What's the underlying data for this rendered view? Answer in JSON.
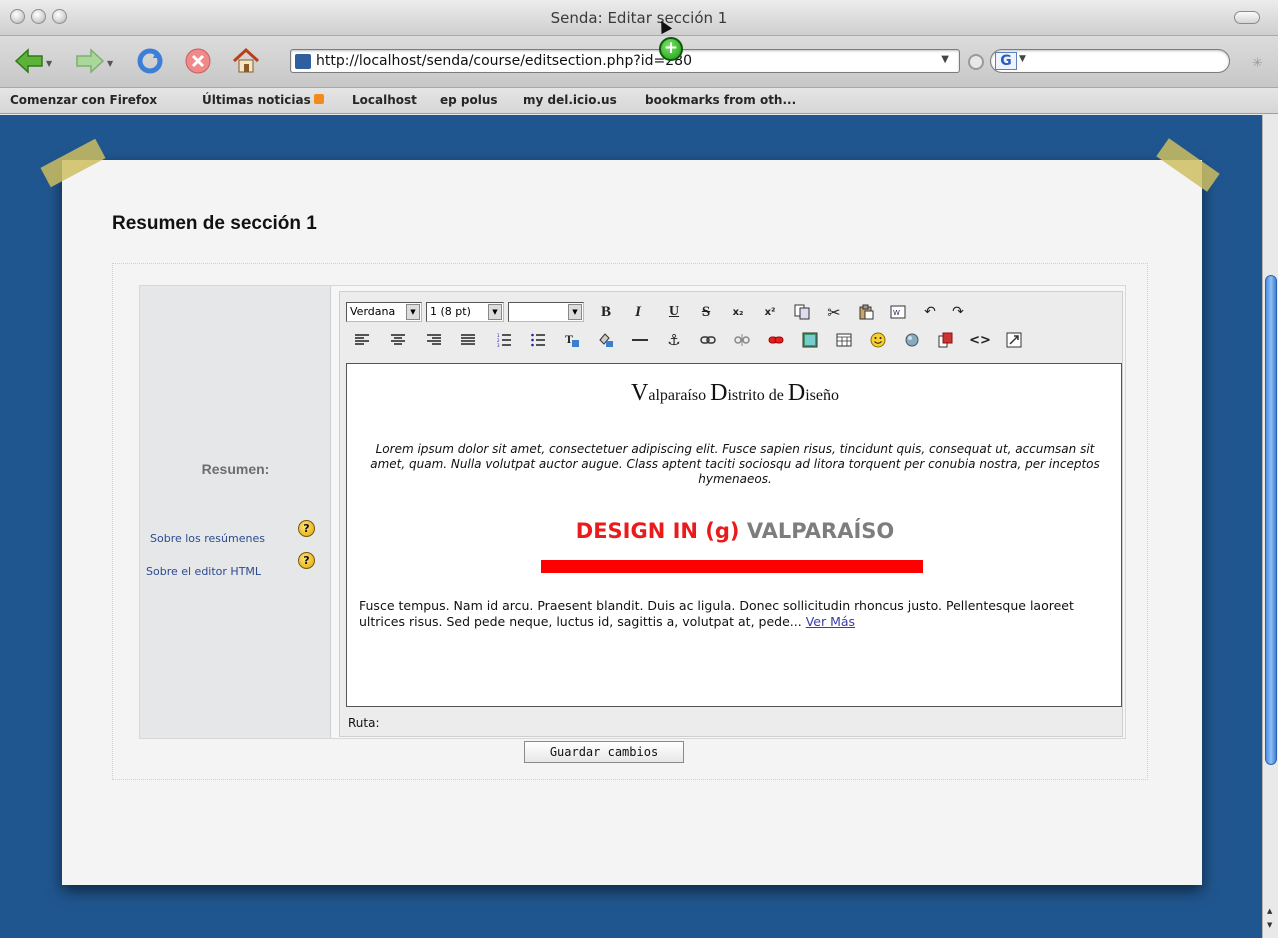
{
  "window": {
    "title": "Senda: Editar sección 1"
  },
  "navbar": {
    "url": "http://localhost/senda/course/editsection.php?id=280",
    "search_placeholder": ""
  },
  "bookmarks": [
    {
      "label": "Comenzar con Firefox"
    },
    {
      "label": "Últimas noticias"
    },
    {
      "label": "Localhost"
    },
    {
      "label": "ep polus"
    },
    {
      "label": "my del.icio.us"
    },
    {
      "label": "bookmarks from oth..."
    }
  ],
  "page": {
    "section_title": "Resumen de sección 1",
    "resumen_label": "Resumen:",
    "help_links": [
      {
        "label": "Sobre los resúmenes",
        "icon": "help-icon"
      },
      {
        "label": "Sobre el editor HTML",
        "icon": "help-icon"
      }
    ],
    "save_button": "Guardar cambios"
  },
  "editor": {
    "font_select": "Verdana",
    "size_select": "1 (8 pt)",
    "format_select": "",
    "toolbar_row1": [
      "bold",
      "italic",
      "underline",
      "strikethrough",
      "subscript",
      "superscript",
      "copy",
      "cut",
      "paste",
      "paste-word",
      "undo",
      "redo"
    ],
    "toolbar_row2": [
      "align-left",
      "align-center",
      "align-right",
      "justify",
      "ordered-list",
      "unordered-list",
      "text-color",
      "highlight-color",
      "horizontal-rule",
      "anchor",
      "link",
      "unlink",
      "prevent-link",
      "image",
      "table",
      "smiley",
      "special-char",
      "search-replace",
      "html-source",
      "fullscreen"
    ],
    "content": {
      "heading_parts": [
        {
          "cap": "V",
          "rest": "alparaíso "
        },
        {
          "cap": "D",
          "rest": "istrito de "
        },
        {
          "cap": "D",
          "rest": "iseño"
        }
      ],
      "lorem": "Lorem ipsum dolor sit amet, consectetuer adipiscing elit. Fusce sapien risus, tincidunt quis, consequat ut, accumsan sit amet, quam. Nulla volutpat auctor augue. Class aptent taciti sociosqu ad litora torquent per conubia nostra, per inceptos hymenaeos.",
      "logo_red": "DESIGN IN (g)",
      "logo_grey": "VALPARAÍSO",
      "body": "Fusce tempus. Nam id arcu. Praesent blandit. Duis ac ligula. Donec sollicitudin rhoncus justo. Pellentesque laoreet ultrices risus. Sed pede neque, luctus id, sagittis a, volutpat at, pede...",
      "more_link": "Ver Más"
    },
    "path_label": "Ruta:"
  },
  "colors": {
    "page_bg": "#20568f",
    "logo_red": "#ea1b1b",
    "logo_grey": "#7d7d7d"
  }
}
